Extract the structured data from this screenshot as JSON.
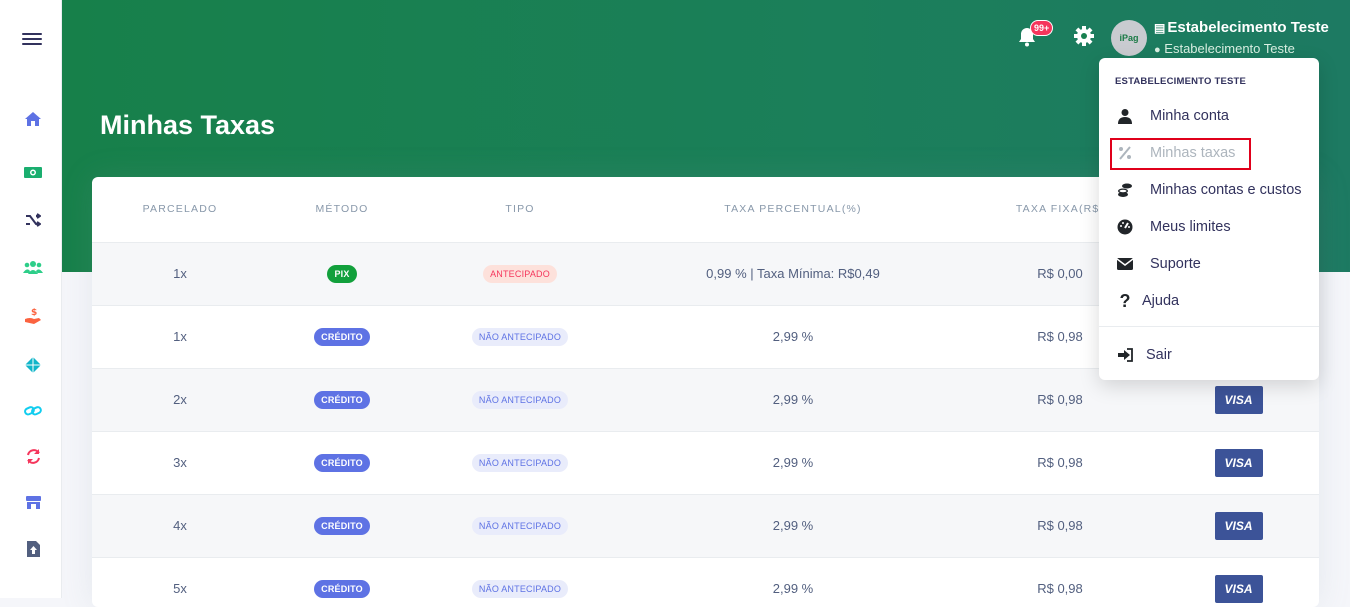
{
  "page": {
    "title": "Minhas Taxas"
  },
  "header": {
    "notifications_badge": "99+",
    "avatar_text": "iPag",
    "establishment_name": "Estabelecimento Teste",
    "user_name": "Estabelecimento Teste"
  },
  "sidebar": {
    "items": [
      {
        "icon": "home-icon",
        "color": "#5e72e4"
      },
      {
        "icon": "money-icon",
        "color": "#2dce89"
      },
      {
        "icon": "shuffle-icon",
        "color": "#32325d"
      },
      {
        "icon": "users-icon",
        "color": "#2dce89"
      },
      {
        "icon": "hand-dollar-icon",
        "color": "#fb6340"
      },
      {
        "icon": "diamond-icon",
        "color": "#11cdef"
      },
      {
        "icon": "link-icon",
        "color": "#11cdef"
      },
      {
        "icon": "sync-icon",
        "color": "#f5365c"
      },
      {
        "icon": "store-icon",
        "color": "#5e72e4"
      },
      {
        "icon": "file-upload-icon",
        "color": "#525f7f"
      }
    ]
  },
  "table": {
    "headers": [
      "PARCELADO",
      "MÉTODO",
      "TIPO",
      "TAXA PERCENTUAL(%)",
      "TAXA FIXA(R$)"
    ],
    "rows": [
      {
        "parcelado": "1x",
        "metodo": "PIX",
        "tipo": "ANTECIPADO",
        "percentual": "0,99 % | Taxa Mínima: R$0,49",
        "fixa": "R$ 0,00",
        "bandeira": ""
      },
      {
        "parcelado": "1x",
        "metodo": "CRÉDITO",
        "tipo": "NÃO ANTECIPADO",
        "percentual": "2,99 %",
        "fixa": "R$ 0,98",
        "bandeira": ""
      },
      {
        "parcelado": "2x",
        "metodo": "CRÉDITO",
        "tipo": "NÃO ANTECIPADO",
        "percentual": "2,99 %",
        "fixa": "R$ 0,98",
        "bandeira": "VISA"
      },
      {
        "parcelado": "3x",
        "metodo": "CRÉDITO",
        "tipo": "NÃO ANTECIPADO",
        "percentual": "2,99 %",
        "fixa": "R$ 0,98",
        "bandeira": "VISA"
      },
      {
        "parcelado": "4x",
        "metodo": "CRÉDITO",
        "tipo": "NÃO ANTECIPADO",
        "percentual": "2,99 %",
        "fixa": "R$ 0,98",
        "bandeira": "VISA"
      },
      {
        "parcelado": "5x",
        "metodo": "CRÉDITO",
        "tipo": "NÃO ANTECIPADO",
        "percentual": "2,99 %",
        "fixa": "R$ 0,98",
        "bandeira": "VISA"
      }
    ]
  },
  "dropdown": {
    "header": "ESTABELECIMENTO TESTE",
    "items": [
      {
        "label": "Minha conta",
        "icon": "user-icon"
      },
      {
        "label": "Minhas taxas",
        "icon": "percent-icon"
      },
      {
        "label": "Minhas contas e custos",
        "icon": "coins-icon"
      },
      {
        "label": "Meus limites",
        "icon": "gauge-icon"
      },
      {
        "label": "Suporte",
        "icon": "envelope-icon"
      },
      {
        "label": "Ajuda",
        "icon": "question-icon"
      },
      {
        "label": "Sair",
        "icon": "sign-out-icon"
      }
    ]
  },
  "colors": {
    "header_green": "#17804a",
    "highlight_red": "#e0001b",
    "primary": "#5e72e4"
  }
}
